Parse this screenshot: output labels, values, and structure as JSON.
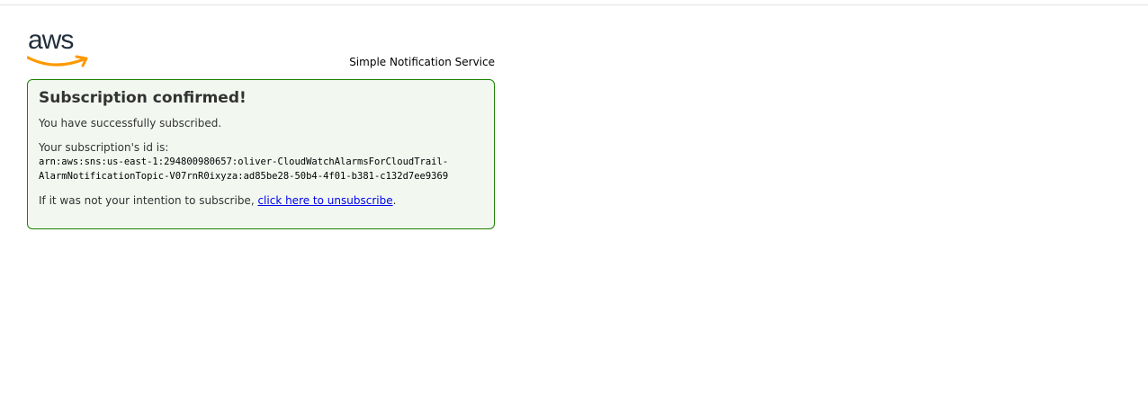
{
  "logo": {
    "text": "aws",
    "smile_color": "#ff9900",
    "text_color": "#232f3e"
  },
  "header": {
    "service_name": "Simple Notification Service"
  },
  "confirmation": {
    "title": "Subscription confirmed!",
    "message": "You have successfully subscribed.",
    "id_label": "Your subscription's id is:",
    "arn_line1": "arn:aws:sns:us-east-1:294800980657:oliver-CloudWatchAlarmsForCloudTrail-",
    "arn_line2": "AlarmNotificationTopic-V07rnR0ixyza:ad85be28-50b4-4f01-b381-c132d7ee9369",
    "unsubscribe_prefix": "If it was not your intention to subscribe, ",
    "unsubscribe_link": "click here to unsubscribe",
    "unsubscribe_suffix": ".",
    "border_color": "#1d8102",
    "background_color": "#f2f8f0"
  }
}
